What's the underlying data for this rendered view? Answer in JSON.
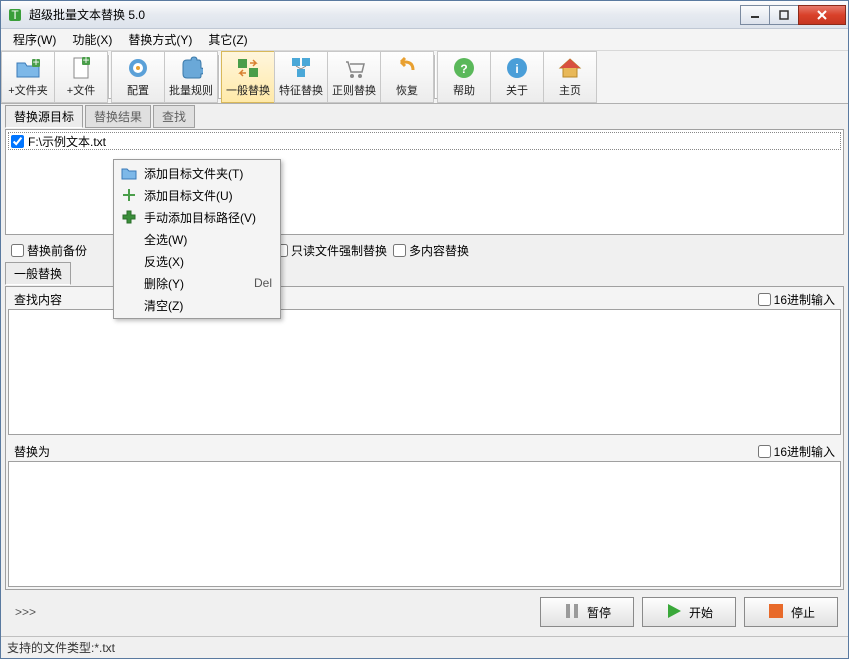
{
  "title": "超级批量文本替换 5.0",
  "menubar": [
    "程序(W)",
    "功能(X)",
    "替换方式(Y)",
    "其它(Z)"
  ],
  "toolbar": [
    {
      "label": "+文件夹",
      "icon": "folder-add"
    },
    {
      "label": "+文件",
      "icon": "file-add"
    },
    {
      "label": "配置",
      "icon": "gear"
    },
    {
      "label": "批量规则",
      "icon": "puzzle"
    },
    {
      "label": "一般替换",
      "icon": "swap",
      "active": true
    },
    {
      "label": "特征替换",
      "icon": "feature"
    },
    {
      "label": "正则替换",
      "icon": "cart"
    },
    {
      "label": "恢复",
      "icon": "undo"
    },
    {
      "label": "帮助",
      "icon": "help"
    },
    {
      "label": "关于",
      "icon": "info"
    },
    {
      "label": "主页",
      "icon": "home"
    }
  ],
  "main_tabs": [
    "替换源目标",
    "替换结果",
    "查找"
  ],
  "file_list": [
    {
      "path": "F:\\示例文本.txt",
      "checked": true
    }
  ],
  "context_menu": [
    {
      "label": "添加目标文件夹(T)",
      "icon": "folder"
    },
    {
      "label": "添加目标文件(U)",
      "icon": "plus-green"
    },
    {
      "label": "手动添加目标路径(V)",
      "icon": "plus-thick"
    },
    {
      "label": "全选(W)"
    },
    {
      "label": "反选(X)"
    },
    {
      "label": "删除(Y)",
      "shortcut": "Del"
    },
    {
      "label": "清空(Z)"
    }
  ],
  "options": {
    "backup": "替换前备份",
    "readonly_force": "只读文件强制替换",
    "multi_content": "多内容替换"
  },
  "inner_tab": "一般替换",
  "find_label": "查找内容",
  "replace_label": "替换为",
  "hex_input": "16进制输入",
  "prompt": ">>>",
  "buttons": {
    "pause": "暂停",
    "start": "开始",
    "stop": "停止"
  },
  "status": {
    "prefix": "支持的文件类型:",
    "value": "*.txt"
  }
}
